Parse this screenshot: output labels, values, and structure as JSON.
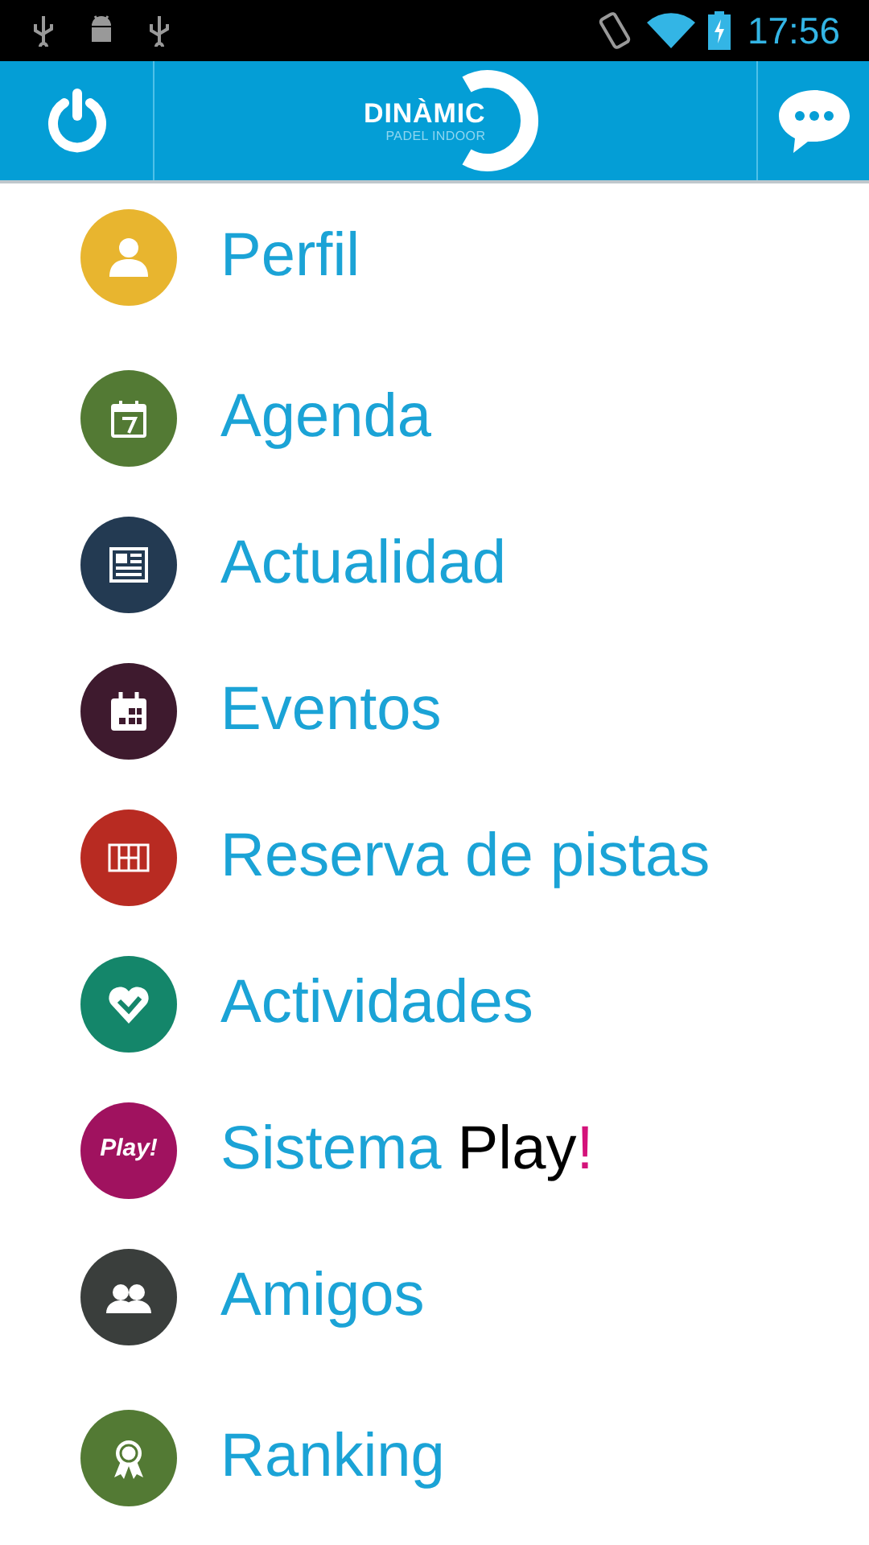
{
  "status_bar": {
    "time": "17:56"
  },
  "header": {
    "logo": {
      "title": "DINÀMIC",
      "subtitle": "PADEL INDOOR"
    }
  },
  "menu": [
    {
      "kind": "profile",
      "label": "Perfil",
      "color": "#e8b52f"
    },
    {
      "kind": "calendar",
      "label": "Agenda",
      "color": "#537a34"
    },
    {
      "kind": "news",
      "label": "Actualidad",
      "color": "#233a52"
    },
    {
      "kind": "events",
      "label": "Eventos",
      "color": "#3e1a2e"
    },
    {
      "kind": "courts",
      "label": "Reserva de pistas",
      "color": "#b82b22"
    },
    {
      "kind": "activities",
      "label": "Actividades",
      "color": "#14866a"
    },
    {
      "kind": "play",
      "label": "Sistema",
      "badge": "Play!",
      "brand": "Play",
      "brand_mark": "!",
      "color": "#a0125f"
    },
    {
      "kind": "friends",
      "label": "Amigos",
      "color": "#3a3e3c"
    },
    {
      "kind": "ranking",
      "label": "Ranking",
      "color": "#537a34"
    }
  ]
}
